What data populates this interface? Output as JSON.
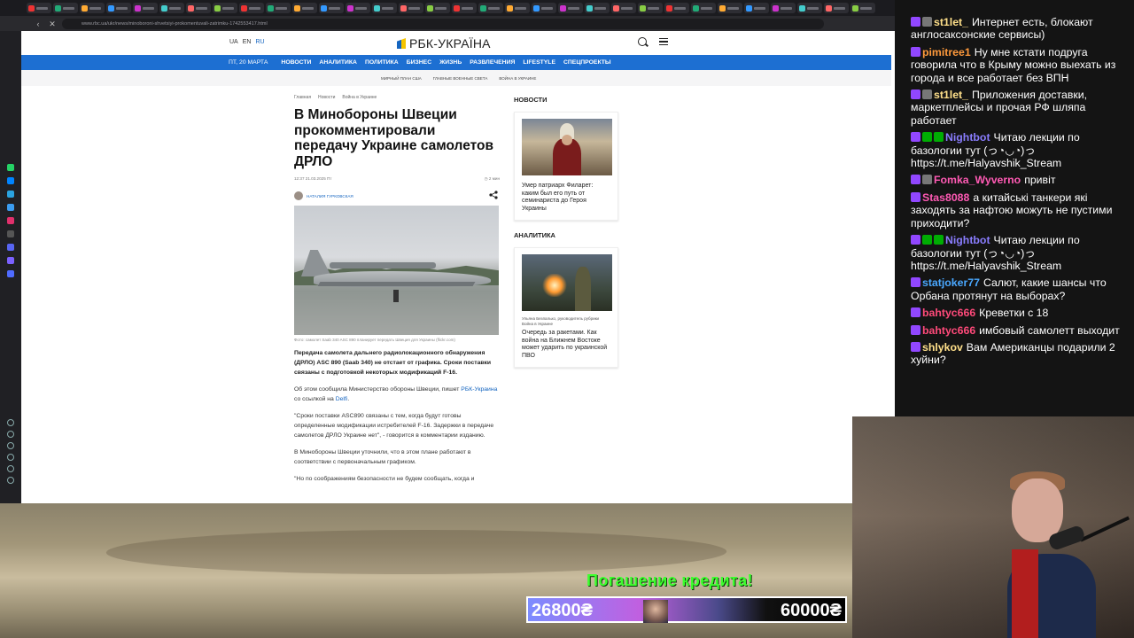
{
  "browser": {
    "url": "www.rbc.ua/ukr/news/minoboroni-shvetsiyi-prokomentuvali-zatrimku-1742553417.html",
    "tab_count": 32
  },
  "site": {
    "langs": [
      "UA",
      "EN",
      "RU"
    ],
    "logo": "РБК-УКРАЇНА",
    "nav_date": "ПТ, 20 МАРТА",
    "nav": [
      "НОВОСТИ",
      "АНАЛИТИКА",
      "ПОЛИТИКА",
      "БИЗНЕС",
      "ЖИЗНЬ",
      "РАЗВЛЕЧЕНИЯ",
      "LIFESTYLE",
      "СПЕЦПРОЕКТЫ"
    ],
    "subnav": [
      "МИРНЫЙ ПЛАН США",
      "ГЛАВНЫЕ ВОЕННЫЕ СВЕТА",
      "ВОЙНА В УКРАИНЕ"
    ]
  },
  "article": {
    "crumbs": [
      "Главная",
      "Новости",
      "Война в Украине"
    ],
    "title": "В Минобороны Швеции прокомментировали передачу Украине самолетов ДРЛО",
    "datetime": "12:37 21.03.2025 Пт",
    "read_time": "2 мин",
    "author": "НАТАЛИЯ ГУРКОВСКАЯ",
    "caption": "Фото: самолет Saab 340 ASC 890 планирует передать Швеция для Украины (flickr.com)",
    "lead": "Передача самолета дальнего радиолокационного обнаружения (ДРЛО) ASC 890 (Saab 340) не отстает от графика. Сроки поставки связаны с подготовкой некоторых модификаций F-16.",
    "p1_a": "Об этом сообщила Министерство обороны Швеции, пишет ",
    "p1_link1": "РБК-Украина",
    "p1_b": " со ссылкой на ",
    "p1_link2": "Delfi",
    "p1_c": ".",
    "p2": "\"Сроки поставки ASC890 связаны с тем, когда будут готовы определенные модификации истребителей F-16. Задержки в передаче самолетов ДРЛО Украине нет\", - говорится в комментарии изданию.",
    "p3": "В Минобороны Швеции уточнили, что в этом плане работают в соответствии с первоначальным графиком.",
    "p4": "\"Но по соображениям безопасности не будем сообщать, когда и"
  },
  "rail": {
    "news_head": "НОВОСТИ",
    "news_title": "Умер патриарх Филарет: каким был его путь от семинариста до Героя Украины",
    "analytics_head": "АНАЛИТИКА",
    "analytics_author": "Ульяна Безпалько, руководитель рубрики Война в Украине",
    "analytics_title": "Очередь за ракетами. Как война на Ближнем Востоке может ударить по украинской ПВО"
  },
  "promo": {
    "title": "Погашение кредита!",
    "current": "26800₴",
    "goal": "60000₴"
  },
  "chat": [
    {
      "user": "st1let_",
      "color": "#ffe08a",
      "badges": [
        "b-purple",
        "b-gray"
      ],
      "text": "Интернет есть, блокают англосаксонские сервисы)"
    },
    {
      "user": "pimitree1",
      "color": "#ff9a3c",
      "badges": [
        "b-purple"
      ],
      "text": "Ну мне кстати подруга говорила что в Крыму можно выехать из города и все работает без ВПН"
    },
    {
      "user": "st1let_",
      "color": "#ffe08a",
      "badges": [
        "b-purple",
        "b-gray"
      ],
      "text": "Приложения доставки, маркетплейсы и прочая РФ шляпа работает"
    },
    {
      "user": "Nightbot",
      "color": "#8a7dff",
      "badges": [
        "b-purple",
        "b-green",
        "b-green"
      ],
      "text": "Читаю лекции по базологии тут (っ◔◡◔)っ https://t.me/Halyavshik_Stream"
    },
    {
      "user": "Fomka_Wyverno",
      "color": "#ff5ab4",
      "badges": [
        "b-purple",
        "b-gray"
      ],
      "text": "привіт"
    },
    {
      "user": "Stas8088",
      "color": "#ff5ab4",
      "badges": [
        "b-purple"
      ],
      "text": "а китайські танкери які заходять за нафтою можуть не пустими приходити?"
    },
    {
      "user": "Nightbot",
      "color": "#8a7dff",
      "badges": [
        "b-purple",
        "b-green",
        "b-green"
      ],
      "text": "Читаю лекции по базологии тут (っ◔◡◔)っ https://t.me/Halyavshik_Stream"
    },
    {
      "user": "statjoker77",
      "color": "#4aa8ff",
      "badges": [
        "b-purple"
      ],
      "text": "Салют, какие шансы что Орбана протянут на выборах?"
    },
    {
      "user": "bahtyc666",
      "color": "#ff4a7a",
      "badges": [
        "b-purple"
      ],
      "text": "Креветки с 18"
    },
    {
      "user": "bahtyc666",
      "color": "#ff4a7a",
      "badges": [
        "b-purple"
      ],
      "text": "имбовый самолетт выходит"
    },
    {
      "user": "shlykov",
      "color": "#ffe08a",
      "badges": [
        "b-purple"
      ],
      "text": "Вам Американцы подарили 2 хуйни?"
    }
  ]
}
